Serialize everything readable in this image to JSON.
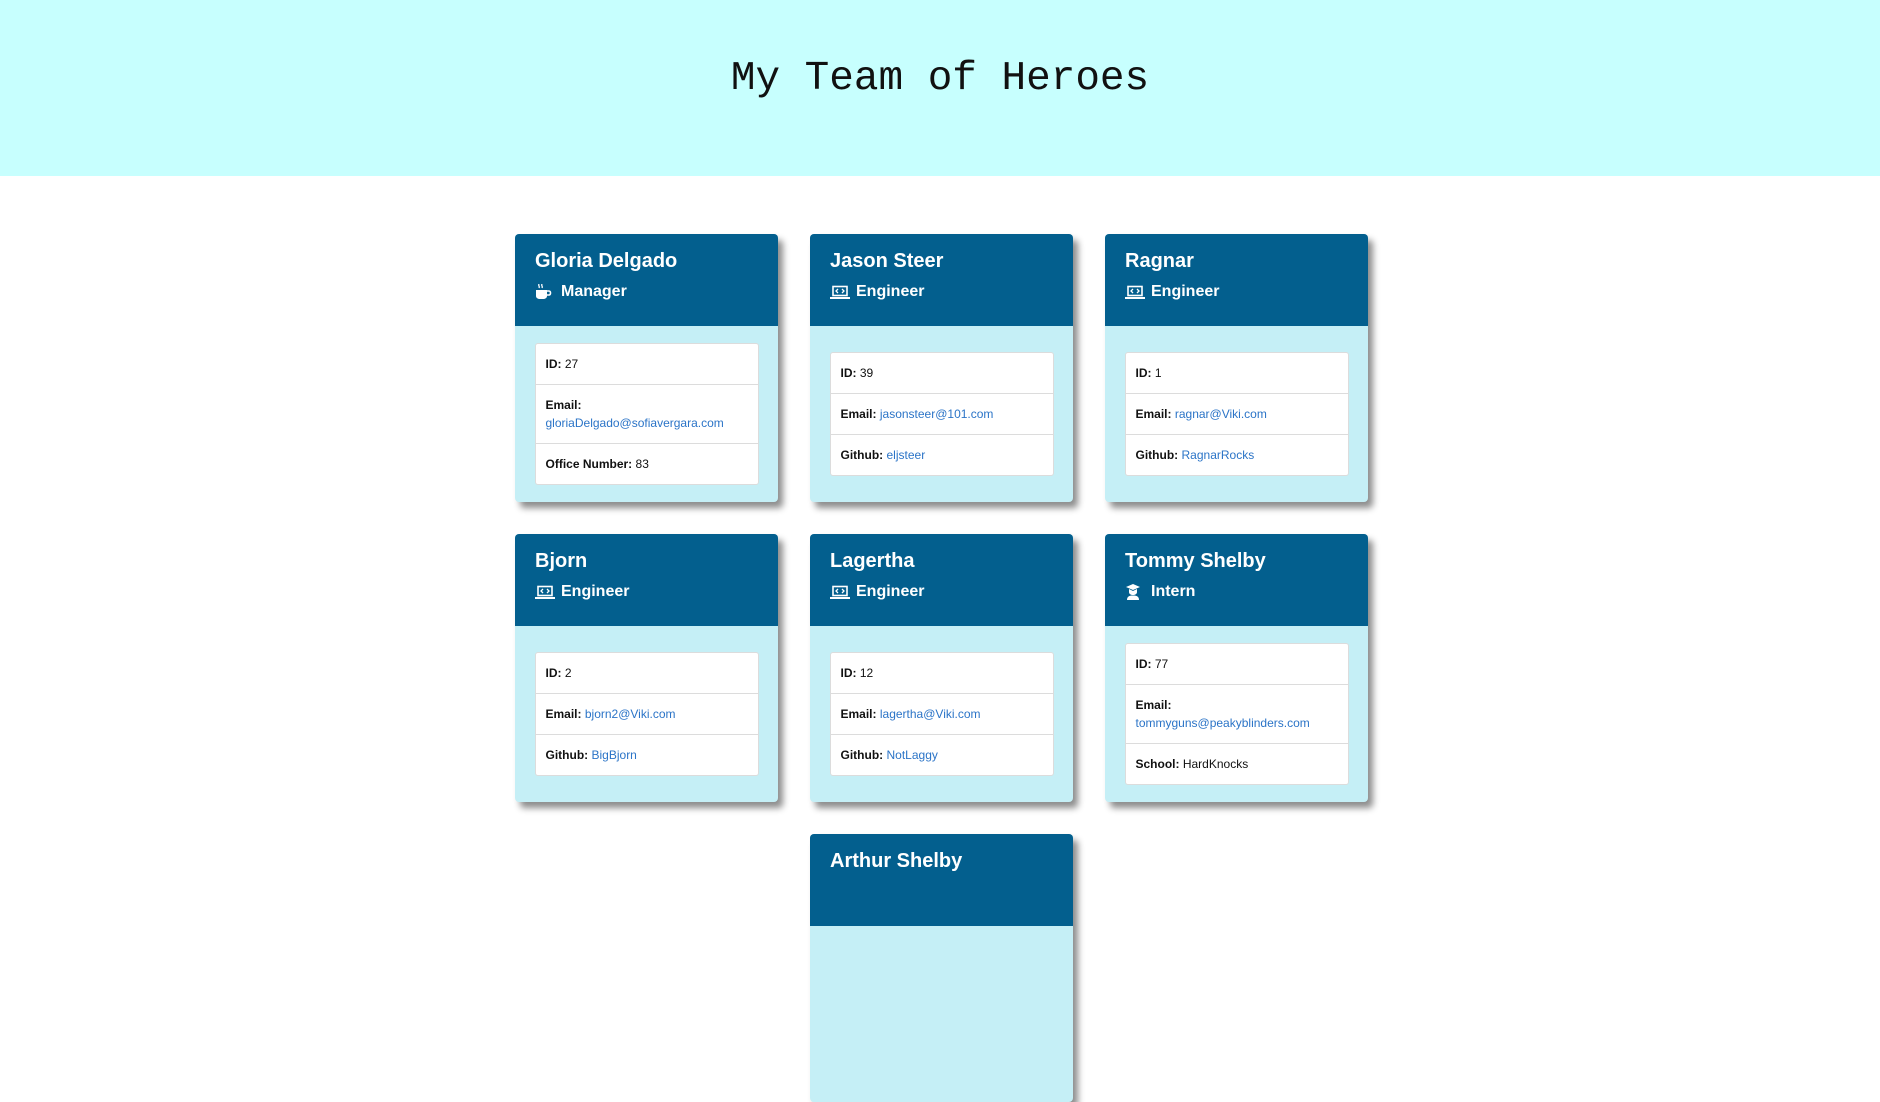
{
  "header": {
    "title": "My Team of Heroes"
  },
  "colors": {
    "header_bg": "#c7fffe",
    "card_head": "#035f8e",
    "card_body": "#c5eff6",
    "link": "#2b74c7"
  },
  "cards": [
    {
      "name": "Gloria Delgado",
      "role": "Manager",
      "icon": "mug-icon",
      "id_label": "ID:",
      "id": "27",
      "email_label": "Email:",
      "email": "gloriaDelgado@sofiavergara.com",
      "extra_label": "Office Number:",
      "extra": "83"
    },
    {
      "name": "Jason Steer",
      "role": "Engineer",
      "icon": "laptop-code-icon",
      "id_label": "ID:",
      "id": "39",
      "email_label": "Email:",
      "email": "jasonsteer@101.com",
      "extra_label": "Github:",
      "extra": "eljsteer"
    },
    {
      "name": "Ragnar",
      "role": "Engineer",
      "icon": "laptop-code-icon",
      "id_label": "ID:",
      "id": "1",
      "email_label": "Email:",
      "email": "ragnar@Viki.com",
      "extra_label": "Github:",
      "extra": "RagnarRocks"
    },
    {
      "name": "Bjorn",
      "role": "Engineer",
      "icon": "laptop-code-icon",
      "id_label": "ID:",
      "id": "2",
      "email_label": "Email:",
      "email": "bjorn2@Viki.com",
      "extra_label": "Github:",
      "extra": "BigBjorn"
    },
    {
      "name": "Lagertha",
      "role": "Engineer",
      "icon": "laptop-code-icon",
      "id_label": "ID:",
      "id": "12",
      "email_label": "Email:",
      "email": "lagertha@Viki.com",
      "extra_label": "Github:",
      "extra": "NotLaggy"
    },
    {
      "name": "Tommy Shelby",
      "role": "Intern",
      "icon": "graduate-icon",
      "id_label": "ID:",
      "id": "77",
      "email_label": "Email:",
      "email": "tommyguns@peakyblinders.com",
      "extra_label": "School:",
      "extra": "HardKnocks"
    },
    {
      "name": "Arthur Shelby"
    }
  ]
}
